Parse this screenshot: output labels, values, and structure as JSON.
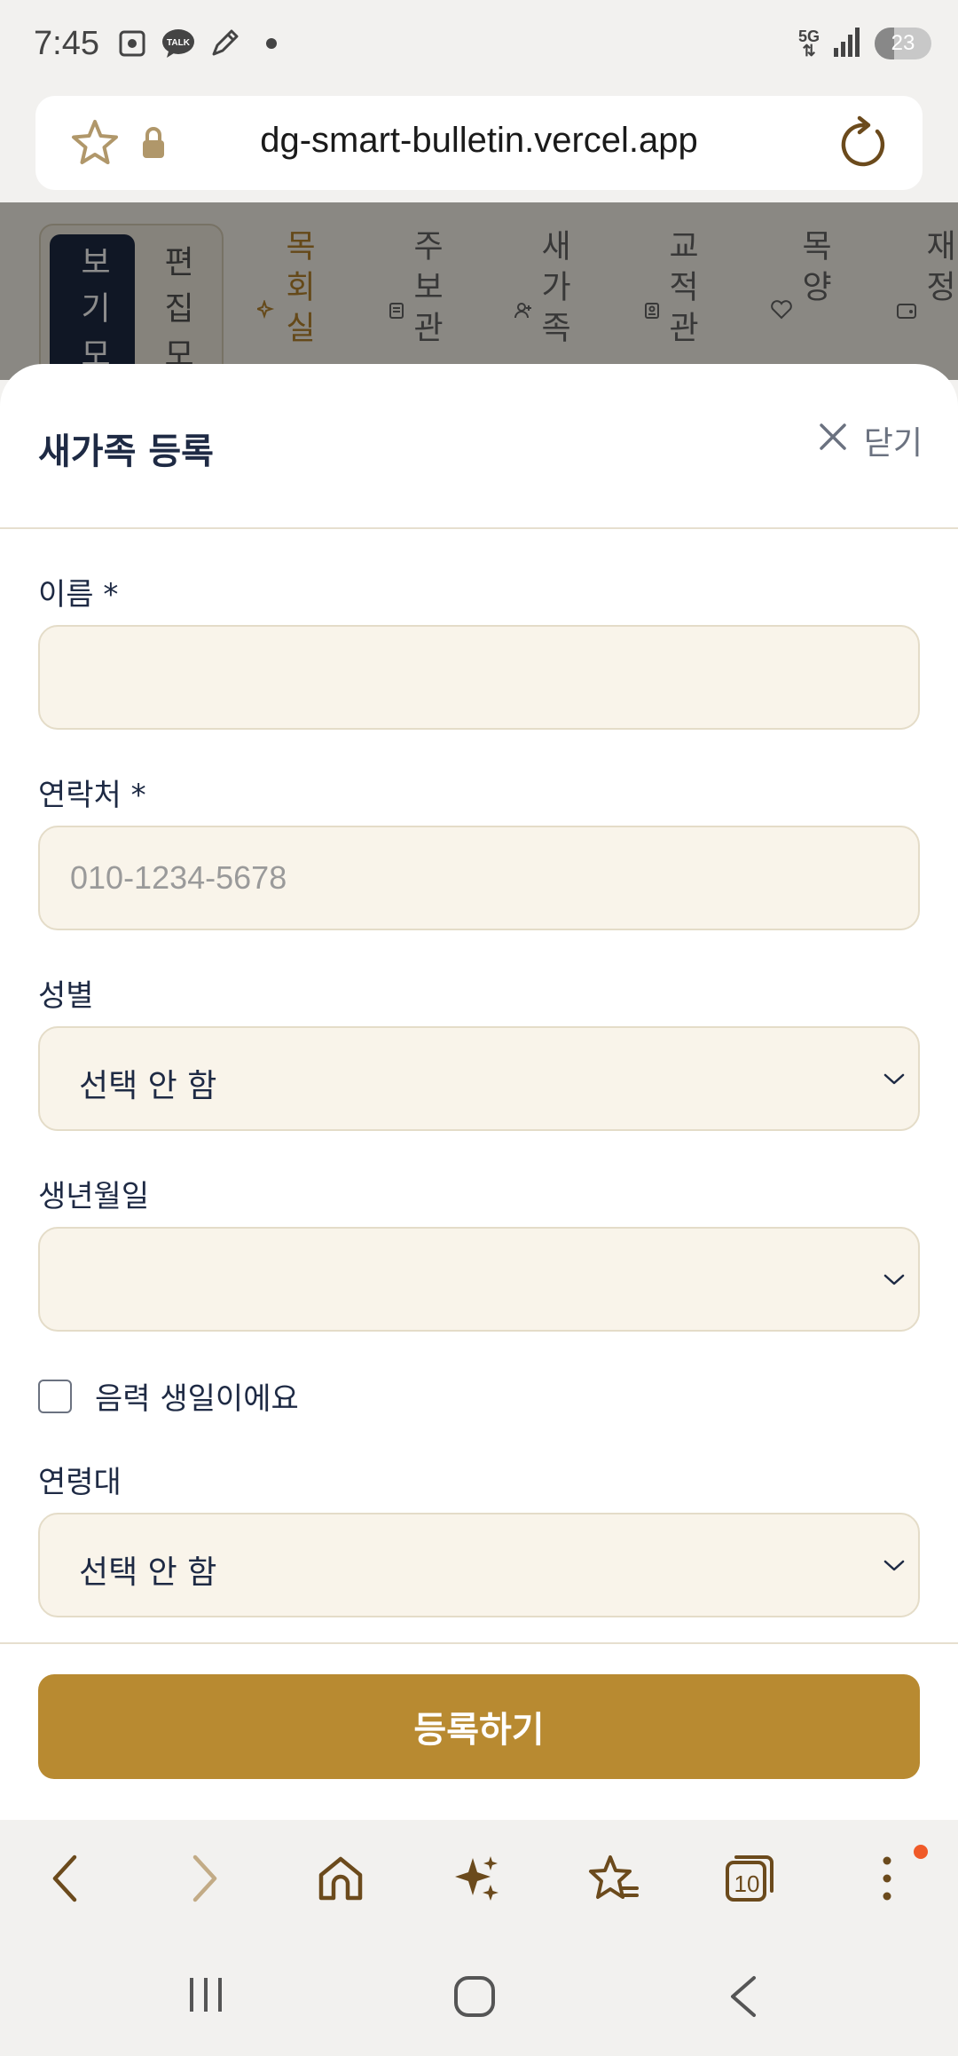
{
  "status_bar": {
    "time": "7:45",
    "network": "5G",
    "battery": "23",
    "icons_left": [
      "screenshot-icon",
      "kakaotalk-icon",
      "pen-icon",
      "dot-icon"
    ],
    "kakao_label": "TALK"
  },
  "url_bar": {
    "url": "dg-smart-bulletin.vercel.app"
  },
  "page": {
    "mode_toggle": {
      "view": "보기모",
      "edit": "편집모"
    },
    "nav_tabs": [
      {
        "label": "목회실",
        "icon": "sparkle-icon",
        "active": true
      },
      {
        "label": "주보관",
        "icon": "document-icon",
        "active": false
      },
      {
        "label": "새가족",
        "icon": "person-add-icon",
        "active": false
      },
      {
        "label": "교적관",
        "icon": "id-card-icon",
        "active": false
      },
      {
        "label": "목양",
        "icon": "heart-hand-icon",
        "active": false
      },
      {
        "label": "재정",
        "icon": "wallet-icon",
        "active": false
      }
    ]
  },
  "sheet": {
    "title": "새가족 등록",
    "close_label": "닫기",
    "fields": {
      "name": {
        "label": "이름 *",
        "value": "",
        "placeholder": ""
      },
      "phone": {
        "label": "연락처 *",
        "value": "",
        "placeholder": "010-1234-5678"
      },
      "gender": {
        "label": "성별",
        "selected": "선택 안 함"
      },
      "birthday": {
        "label": "생년월일",
        "selected": ""
      },
      "lunar": {
        "label": "음력 생일이에요",
        "checked": false
      },
      "age_group": {
        "label": "연령대",
        "selected": "선택 안 함"
      }
    },
    "submit_label": "등록하기"
  },
  "browser_toolbar": {
    "tabs_count": "10",
    "items": [
      "back-icon",
      "forward-icon",
      "home-icon",
      "ai-sparkle-icon",
      "bookmarks-icon",
      "tabs-icon",
      "more-icon"
    ]
  },
  "colors": {
    "accent": "#b88a31",
    "navy": "#1e2a44",
    "field_bg": "#f9f4ea",
    "field_border": "#e4dcc8"
  }
}
